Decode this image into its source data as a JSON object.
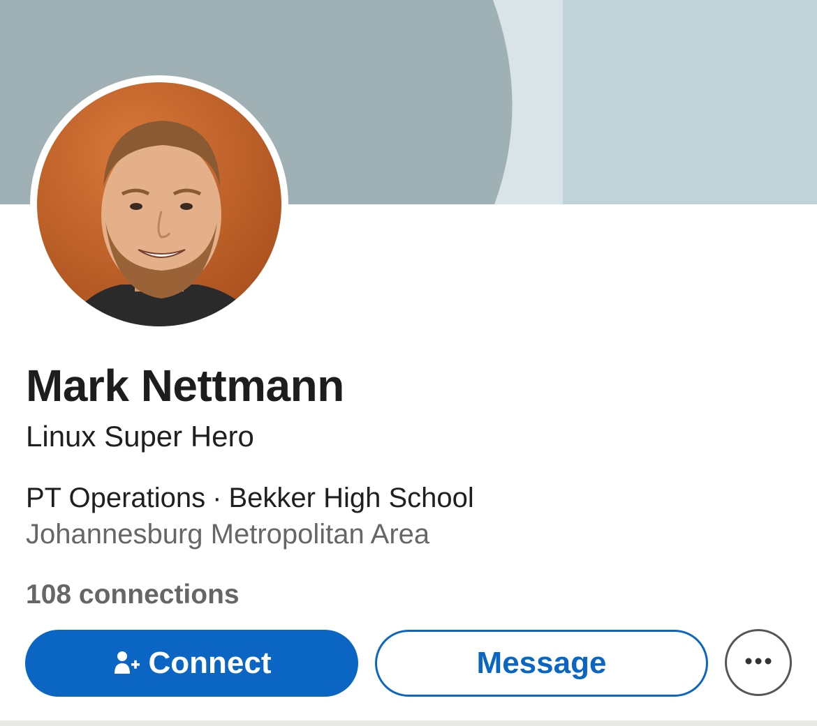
{
  "profile": {
    "name": "Mark Nettmann",
    "headline": "Linux Super Hero",
    "experience": {
      "role": "PT Operations",
      "separator": "·",
      "organization": "Bekker High School"
    },
    "location": "Johannesburg Metropolitan Area",
    "connections": "108 connections"
  },
  "actions": {
    "connect_label": "Connect",
    "connect_icon": "add-person-icon",
    "message_label": "Message",
    "more_icon": "more-horizontal-icon"
  },
  "colors": {
    "accent": "#0a66c2",
    "banner_dark": "#9fb1b4",
    "banner_light": "#c0d3d8",
    "avatar_background": "#c4622a"
  }
}
